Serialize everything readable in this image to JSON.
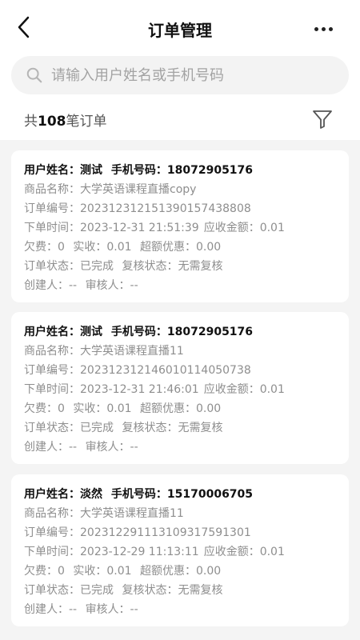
{
  "header": {
    "title": "订单管理"
  },
  "search": {
    "placeholder": "请输入用户姓名或手机号码"
  },
  "summary": {
    "prefix": "共",
    "count": "108",
    "suffix": "笔订单"
  },
  "orders": [
    {
      "user_label": "用户姓名：测试",
      "phone_label": "手机号码：18072905176",
      "product": "商品名称：大学英语课程直播copy",
      "order_no": "订单编号：2023123121513901574388​08",
      "time": "下单时间：2023-12-31 21:51:39",
      "receivable": "应收金额：0.01",
      "owed": "欠费：0",
      "received": "实收：0.01",
      "discount": "超额优惠：0.00",
      "status": "订单状态：已完成",
      "review_status": "复核状态：无需复核",
      "creator": "创建人：--",
      "reviewer": "审核人：--"
    },
    {
      "user_label": "用户姓名：测试",
      "phone_label": "手机号码：18072905176",
      "product": "商品名称：大学英语课程直播11",
      "order_no": "订单编号：20231231214601011405073​8",
      "time": "下单时间：2023-12-31 21:46:01",
      "receivable": "应收金额：0.01",
      "owed": "欠费：0",
      "received": "实收：0.01",
      "discount": "超额优惠：0.00",
      "status": "订单状态：已完成",
      "review_status": "复核状态：无需复核",
      "creator": "创建人：--",
      "reviewer": "审核人：--"
    },
    {
      "user_label": "用户姓名：淡然",
      "phone_label": "手机号码：15170006705",
      "product": "商品名称：大学英语课程直播11",
      "order_no": "订单编号：20231229111310931759130​1",
      "time": "下单时间：2023-12-29 11:13:11",
      "receivable": "应收金额：0.01",
      "owed": "欠费：0",
      "received": "实收：0.01",
      "discount": "超额优惠：0.00",
      "status": "订单状态：已完成",
      "review_status": "复核状态：无需复核",
      "creator": "创建人：--",
      "reviewer": "审核人：--"
    }
  ]
}
